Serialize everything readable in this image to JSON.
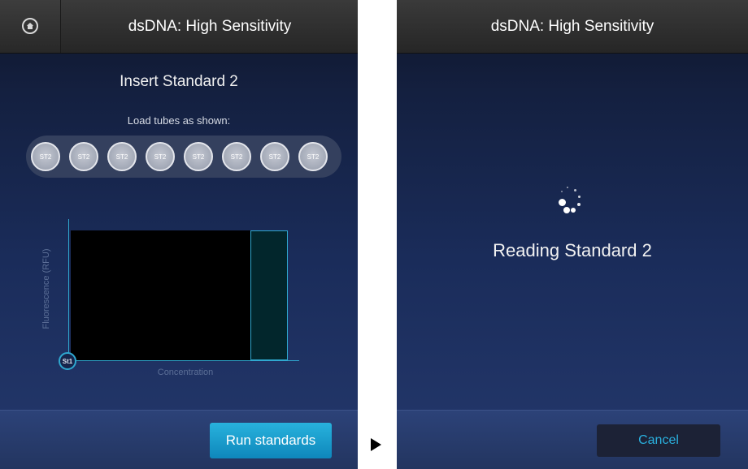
{
  "left_screen": {
    "title": "dsDNA: High Sensitivity",
    "home_icon": "home-icon",
    "instruction": "Insert Standard 2",
    "load_label": "Load tubes as shown:",
    "tubes": [
      "ST2",
      "ST2",
      "ST2",
      "ST2",
      "ST2",
      "ST2",
      "ST2",
      "ST2"
    ],
    "graph": {
      "y_label": "Fluorescence (RFU)",
      "x_label": "Concentration",
      "marker": "St1"
    },
    "run_button": "Run standards"
  },
  "right_screen": {
    "title": "dsDNA: High Sensitivity",
    "spinner_icon": "loading-spinner-icon",
    "status": "Reading Standard 2",
    "cancel_button": "Cancel"
  },
  "transition_icon": "play-arrow-icon",
  "colors": {
    "accent": "#2AB0DE",
    "button_primary": "#1A9CCB",
    "header": "#2E2E2E",
    "background": "#1A2C5A"
  }
}
